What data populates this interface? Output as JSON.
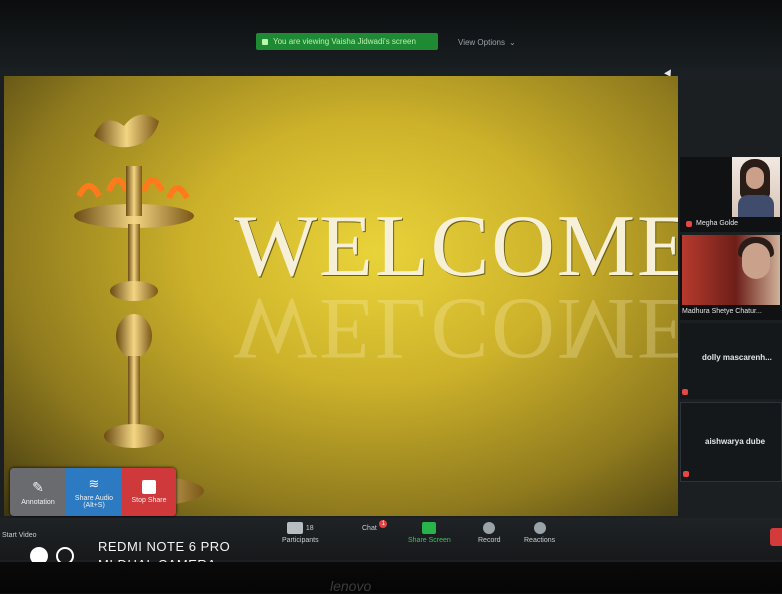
{
  "meeting": {
    "viewing_banner": "You are viewing Vaisha Jidwadi's screen",
    "view_options": "View Options",
    "view_options_chevron": "⌄"
  },
  "slide": {
    "headline": "WELCOME"
  },
  "share_toolbar": {
    "annotate_label": "Annotation",
    "audio_label": "Share Audio (Alt+S)",
    "stop_label": "Stop Share"
  },
  "participants_panel": {
    "tiles": [
      {
        "name": "Megha Golde"
      },
      {
        "name": "Madhura Shetye Chatur..."
      },
      {
        "name": "dolly mascarenh..."
      },
      {
        "name": "aishwarya dube"
      }
    ]
  },
  "controls": {
    "start_video": "Start Video",
    "participants_label": "Participants",
    "participants_count": "18",
    "chat_label": "Chat",
    "chat_badge": "1",
    "share_screen_label": "Share Screen",
    "record_label": "Record",
    "reactions_label": "Reactions"
  },
  "watermark": {
    "line1": "REDMI NOTE 6 PRO",
    "line2": "MI DUAL CAMERA"
  },
  "bezel": {
    "brand": "lenovo"
  },
  "colors": {
    "share_green": "#1f8a34",
    "stop_red": "#d0393b",
    "audio_blue": "#2b7ac2"
  }
}
